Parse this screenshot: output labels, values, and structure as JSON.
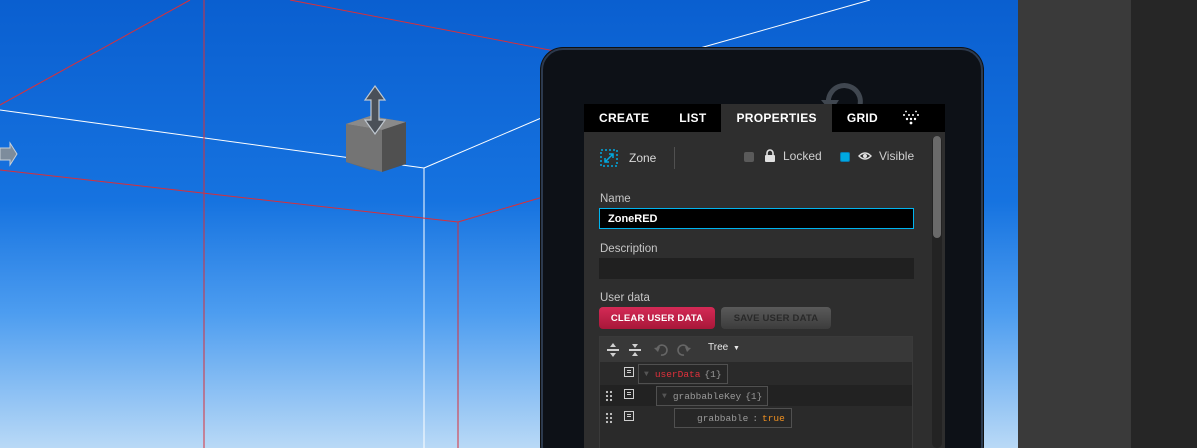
{
  "panel": {
    "tabs": [
      {
        "label": "CREATE"
      },
      {
        "label": "LIST"
      },
      {
        "label": "PROPERTIES",
        "active": true
      },
      {
        "label": "GRID"
      }
    ],
    "particles_icon": "particles-icon"
  },
  "entity": {
    "type_label": "Zone",
    "type_icon": "zone-icon",
    "locked_label": "Locked",
    "locked_checked": false,
    "visible_label": "Visible",
    "visible_checked": true
  },
  "fields": {
    "name_label": "Name",
    "name_value": "ZoneRED",
    "description_label": "Description",
    "description_value": "",
    "userdata_label": "User data"
  },
  "buttons": {
    "clear_user_data": "CLEAR USER DATA",
    "save_user_data": "SAVE USER DATA"
  },
  "json_editor": {
    "mode": "Tree",
    "rows": [
      {
        "key": "userData",
        "count": "{1}",
        "expanded": true
      },
      {
        "key": "grabbableKey",
        "count": "{1}",
        "expanded": true
      },
      {
        "key": "grabbable",
        "colon": ":",
        "value": "true"
      }
    ]
  },
  "colors": {
    "accent_blue": "#00b4ef",
    "clear_red": "#c41e48",
    "sky_top": "#0a5fd0",
    "sky_bottom": "#b9d9f6"
  }
}
